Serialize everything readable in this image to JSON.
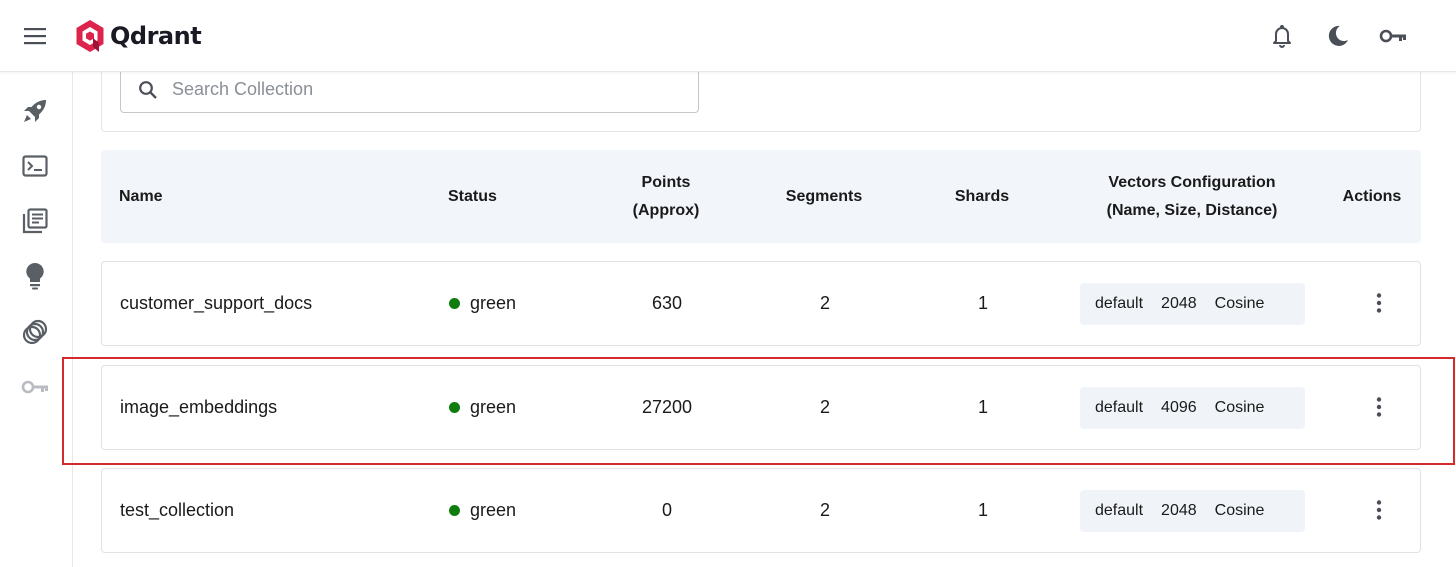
{
  "app": {
    "brand": "Qdrant",
    "brand_color": "#dc244c"
  },
  "topbar": {
    "icons": [
      "menu-icon",
      "bell-icon",
      "moon-icon",
      "key-icon"
    ]
  },
  "sidebar": {
    "items": [
      {
        "icon": "rocket-icon"
      },
      {
        "icon": "terminal-icon"
      },
      {
        "icon": "collections-icon"
      },
      {
        "icon": "lightbulb-icon"
      },
      {
        "icon": "datasets-icon"
      },
      {
        "icon": "key-icon"
      }
    ]
  },
  "search": {
    "placeholder": "Search Collection",
    "value": ""
  },
  "table": {
    "headers": {
      "name": "Name",
      "status": "Status",
      "points_l1": "Points",
      "points_l2": "(Approx)",
      "segments": "Segments",
      "shards": "Shards",
      "vectors_l1": "Vectors Configuration",
      "vectors_l2": "(Name, Size, Distance)",
      "actions": "Actions"
    },
    "rows": [
      {
        "name": "customer_support_docs",
        "status": "green",
        "points": "630",
        "segments": "2",
        "shards": "1",
        "vec_name": "default",
        "vec_size": "2048",
        "vec_distance": "Cosine"
      },
      {
        "name": "image_embeddings",
        "status": "green",
        "points": "27200",
        "segments": "2",
        "shards": "1",
        "vec_name": "default",
        "vec_size": "4096",
        "vec_distance": "Cosine"
      },
      {
        "name": "test_collection",
        "status": "green",
        "points": "0",
        "segments": "2",
        "shards": "1",
        "vec_name": "default",
        "vec_size": "2048",
        "vec_distance": "Cosine"
      }
    ]
  },
  "colors": {
    "status_green": "#0e7d0e",
    "highlight": "#d42a2a",
    "header_bg": "#f2f6fa"
  }
}
